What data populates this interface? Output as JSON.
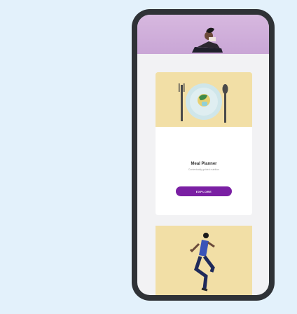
{
  "meal_card": {
    "title": "Meal Planner",
    "subtitle": "Contextually guided nutrition",
    "button_label": "EXPLORE"
  },
  "colors": {
    "page_bg": "#e3f1fb",
    "phone_frame": "#2f3236",
    "header_banner": "#d7b8df",
    "card_image_bg": "#f2dfa6",
    "accent_button": "#7a1fa3"
  },
  "icons": {
    "meal_image": "plate-fork-spoon-illustration",
    "header_image": "reclining-person-illustration",
    "fitness_image": "running-person-illustration"
  }
}
